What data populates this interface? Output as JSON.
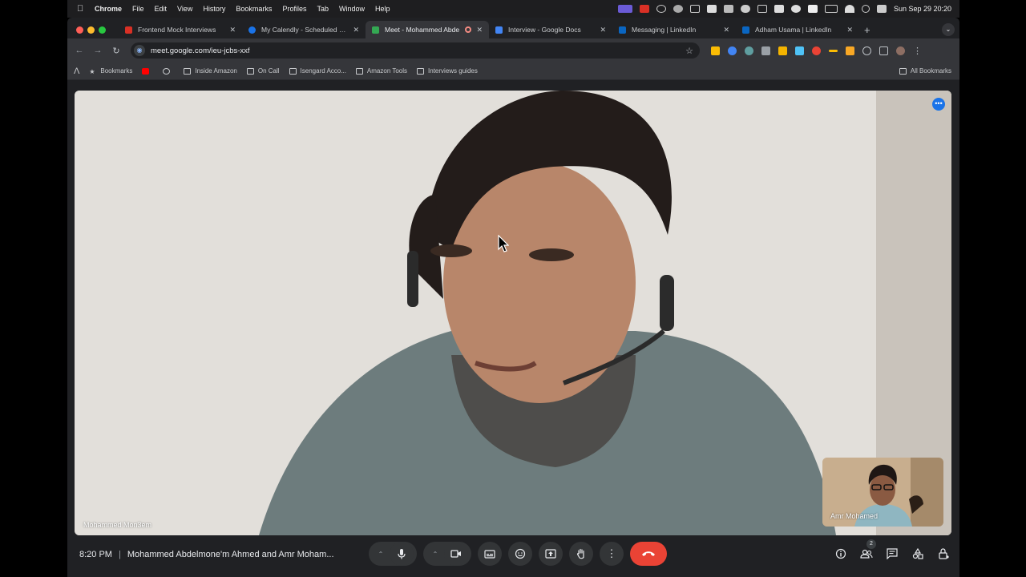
{
  "menubar": {
    "app_name": "Chrome",
    "items": [
      "File",
      "Edit",
      "View",
      "History",
      "Bookmarks",
      "Profiles",
      "Tab",
      "Window",
      "Help"
    ],
    "clock": "Sun Sep 29  20:20"
  },
  "tabs": [
    {
      "title": "Frontend Mock Interviews",
      "favicon_color": "#d93025",
      "active": false
    },
    {
      "title": "My Calendly - Scheduled Eve",
      "favicon_color": "#1a73e8",
      "active": false
    },
    {
      "title": "Meet - Mohammed Abde",
      "favicon_color": "#34a853",
      "active": true
    },
    {
      "title": "Interview - Google Docs",
      "favicon_color": "#4285f4",
      "active": false
    },
    {
      "title": "Messaging | LinkedIn",
      "favicon_color": "#0a66c2",
      "active": false
    },
    {
      "title": "Adham Usama | LinkedIn",
      "favicon_color": "#0a66c2",
      "active": false
    }
  ],
  "omnibox": {
    "url": "meet.google.com/ieu-jcbs-xxf"
  },
  "bookmarks": {
    "items": [
      "Bookmarks",
      "Inside Amazon",
      "On Call",
      "Isengard Acco...",
      "Amazon Tools",
      "Interviews guides"
    ],
    "all_label": "All Bookmarks"
  },
  "meet": {
    "main_participant": "Mohammed Mon3em",
    "pip_participant": "Amr Mohamed",
    "time": "8:20 PM",
    "meeting_title": "Mohammed Abdelmone'm Ahmed and Amr Moham...",
    "participants_count": "2",
    "colors": {
      "end_call": "#ea4335",
      "accent": "#1a73e8"
    }
  }
}
